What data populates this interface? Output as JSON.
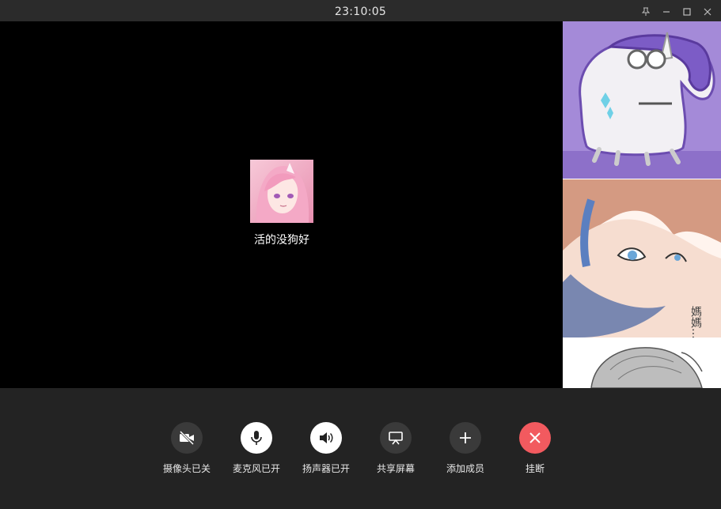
{
  "window": {
    "title_time": "23:10:05",
    "controls": [
      "pin-icon",
      "minimize-icon",
      "maximize-icon",
      "close-icon"
    ]
  },
  "call": {
    "caller_name": "活的没狗好",
    "side_participants": [
      "unicorn-avatar",
      "anime-boy-avatar",
      "manga-avatar"
    ],
    "side_text": "媽媽…"
  },
  "toolbar": {
    "camera_label": "摄像头已关",
    "mic_label": "麦克风已开",
    "speaker_label": "扬声器已开",
    "share_label": "共享屏幕",
    "add_label": "添加成员",
    "hangup_label": "挂断"
  },
  "colors": {
    "hangup": "#f25a5f",
    "background": "#232323",
    "video_bg": "#000000",
    "thumb_purple": "#a48ad8"
  }
}
